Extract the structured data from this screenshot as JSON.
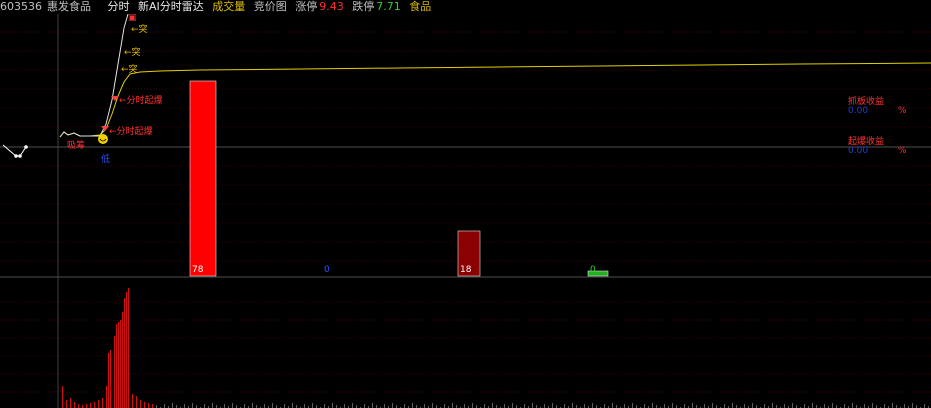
{
  "header": {
    "code": "603536",
    "name": "惠发食品",
    "tab_intraday": "分时",
    "tab_ai": "新AI分时雷达",
    "tab_volume": "成交量",
    "tab_bid": "竞价图",
    "limit_up_label": "涨停",
    "limit_up_value": "9.43",
    "limit_down_label": "跌停",
    "limit_down_value": "7.71",
    "sector": "食品"
  },
  "signals": {
    "break_1": "突",
    "break_2": "突",
    "break_3": "突",
    "surge_1": "分时起爆",
    "surge_2": "分时起爆",
    "suction": "吸筹",
    "low_mark": "低"
  },
  "returns": {
    "board_label": "抓板收益",
    "board_value": "0.00",
    "board_unit": "%",
    "surge_label": "起爆收益",
    "surge_value": "0.00",
    "surge_unit": "%"
  },
  "bars": [
    {
      "value": "78",
      "level": 78,
      "color": "#ff0000"
    },
    {
      "value": "0",
      "level": 0,
      "color": "#1a2a80"
    },
    {
      "value": "18",
      "level": 18,
      "color": "#8b0000"
    },
    {
      "value": "0",
      "level": 2,
      "color": "#20b020"
    }
  ],
  "colors": {
    "price_line": "#e0d000",
    "grid": "#3a0000",
    "separator": "#404040",
    "volume": "#d01010"
  }
}
